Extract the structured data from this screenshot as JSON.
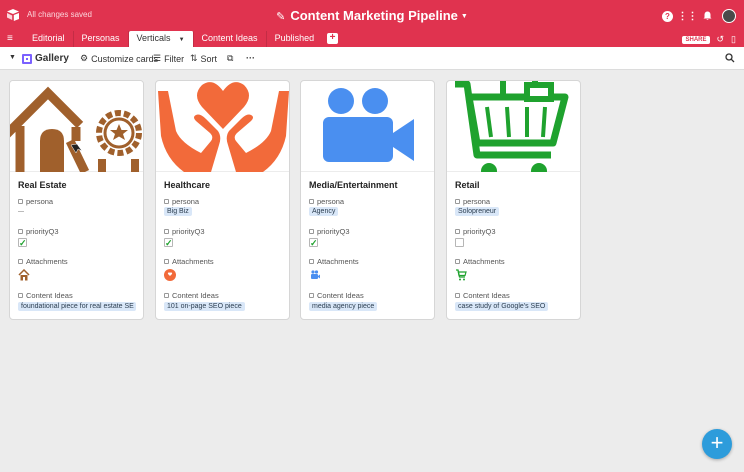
{
  "window": {
    "controls": [
      "close",
      "minimize",
      "zoom"
    ]
  },
  "header": {
    "saved_status": "All changes saved",
    "base_title": "Content Marketing Pipeline",
    "icons": [
      "help-icon",
      "grid-icon",
      "bell-icon",
      "avatar"
    ]
  },
  "tabs": {
    "items": [
      {
        "label": "Editorial",
        "active": false
      },
      {
        "label": "Personas",
        "active": false
      },
      {
        "label": "Verticals",
        "active": true
      },
      {
        "label": "Content Ideas",
        "active": false
      },
      {
        "label": "Published",
        "active": false
      }
    ],
    "add_symbol": "+",
    "share_label": "SHARE"
  },
  "toolbar": {
    "view_name": "Gallery",
    "customize_label": "Customize cards",
    "filter_label": "Filter",
    "sort_label": "Sort",
    "more_label": "···"
  },
  "field_labels": {
    "persona": "persona",
    "priority": "priorityQ3",
    "attachments": "Attachments",
    "content_ideas": "Content Ideas"
  },
  "cards": [
    {
      "title": "Real Estate",
      "persona": "",
      "priority_checked": true,
      "content_idea": "foundational piece for real estate SE",
      "image": "house-icon",
      "image_color": "#a0602c"
    },
    {
      "title": "Healthcare",
      "persona": "Big Biz",
      "priority_checked": true,
      "content_idea": "101 on-page SEO piece",
      "image": "heart-hands-icon",
      "image_color": "#f26a3a"
    },
    {
      "title": "Media/Entertainment",
      "persona": "Agency",
      "priority_checked": true,
      "content_idea": "media agency piece",
      "image": "video-camera-icon",
      "image_color": "#4a8ff0"
    },
    {
      "title": "Retail",
      "persona": "Solopreneur",
      "priority_checked": false,
      "content_idea": "case study of Google's SEO",
      "image": "shopping-cart-icon",
      "image_color": "#1fa22e"
    }
  ],
  "colors": {
    "brand": "#e0334f",
    "fab": "#2d9cdb",
    "pill": "#d9e7f8"
  },
  "fab_symbol": "+"
}
